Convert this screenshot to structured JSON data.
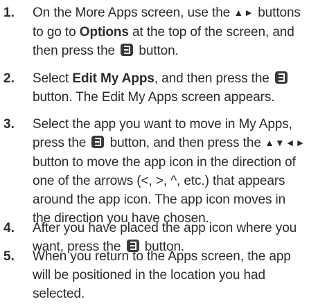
{
  "steps": [
    {
      "num": "1.",
      "p1": "On the More Apps screen, use the ",
      "arrows": "▲►",
      "p2": " buttons to go to ",
      "bold": "Options",
      "p3": " at the top of the screen, and then press the ",
      "p4": " button."
    },
    {
      "num": "2.",
      "p1": "Select ",
      "bold": "Edit My Apps",
      "p2": ", and then press the ",
      "p3": " button. The Edit My Apps screen appears."
    },
    {
      "num": "3.",
      "p1": "Select the app you want to move in My Apps, press the ",
      "p2": " button, and then press the ",
      "arrows": "▲▼◄►",
      "p3": " button to move the app icon in the direction of one of the arrows (<, >, ^, etc.) that appears around the app icon. The app icon moves in the direction you have chosen."
    },
    {
      "num": "4.",
      "p1": "After you have placed the app icon where you want, press the ",
      "p2": " button."
    },
    {
      "num": "5.",
      "p1": "When you return to the Apps screen, the app will be positioned in the location you had selected."
    }
  ],
  "icons": {
    "enter_button_icon": "remote-enter-button-icon",
    "icon_color": "#3a3a3a"
  }
}
